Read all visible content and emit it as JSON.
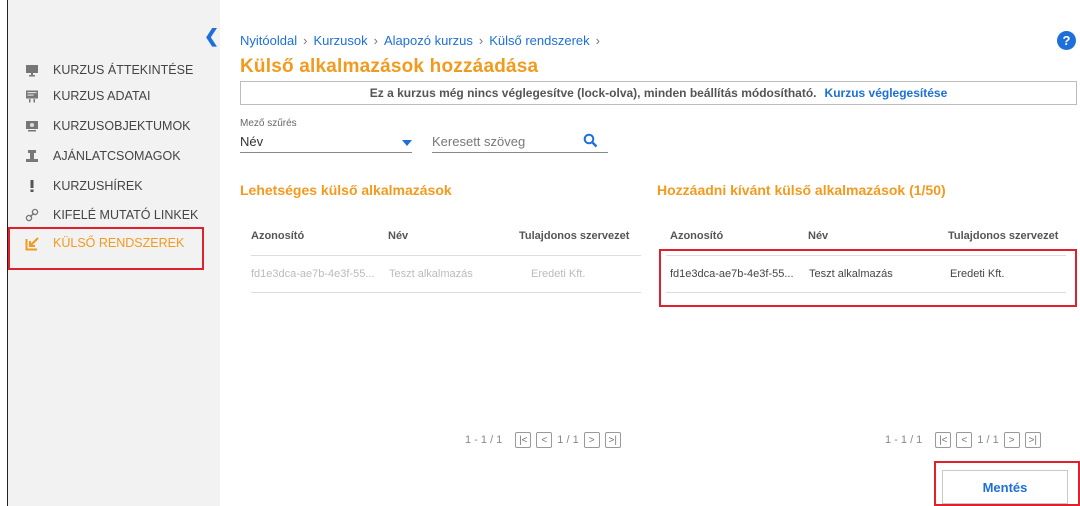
{
  "sidebar": {
    "items": [
      {
        "label": "KURZUS ÁTTEKINTÉSE",
        "icon": "presentation-icon"
      },
      {
        "label": "KURZUS ADATAI",
        "icon": "board-icon"
      },
      {
        "label": "KURZUSOBJEKTUMOK",
        "icon": "projector-icon"
      },
      {
        "label": "AJÁNLATCSOMAGOK",
        "icon": "podium-icon"
      },
      {
        "label": "KURZUSHÍREK",
        "icon": "exclamation-icon"
      },
      {
        "label": "KIFELÉ MUTATÓ LINKEK",
        "icon": "link-icon"
      },
      {
        "label": "KÜLSŐ RENDSZEREK",
        "icon": "external-arrow-icon",
        "active": true
      }
    ]
  },
  "breadcrumb": [
    "Nyitóoldal",
    "Kurzusok",
    "Alapozó kurzus",
    "Külső rendszerek"
  ],
  "page_title": "Külső alkalmazások hozzáadása",
  "notice": {
    "text": "Ez a kurzus még nincs véglegesítve (lock-olva), minden beállítás módosítható.",
    "link": "Kurzus véglegesítése"
  },
  "filter": {
    "label": "Mező szűrés",
    "value": "Név",
    "search_placeholder": "Keresett szöveg"
  },
  "available": {
    "title": "Lehetséges külső alkalmazások",
    "headers": [
      "Azonosító",
      "Név",
      "Tulajdonos szervezet"
    ],
    "rows": [
      [
        "fd1e3dca-ae7b-4e3f-55...",
        "Teszt alkalmazás",
        "Eredeti Kft."
      ]
    ],
    "pager": {
      "range": "1 - 1 / 1",
      "page": "1 / 1"
    }
  },
  "selected": {
    "title": "Hozzáadni kívánt külső alkalmazások (1/50)",
    "headers": [
      "Azonosító",
      "Név",
      "Tulajdonos szervezet"
    ],
    "rows": [
      [
        "fd1e3dca-ae7b-4e3f-55...",
        "Teszt alkalmazás",
        "Eredeti Kft."
      ]
    ],
    "pager": {
      "range": "1 - 1 / 1",
      "page": "1 / 1"
    }
  },
  "save_label": "Mentés",
  "colors": {
    "accent": "#f39a1e",
    "link": "#1e6fd9",
    "highlight": "#e0202a"
  }
}
